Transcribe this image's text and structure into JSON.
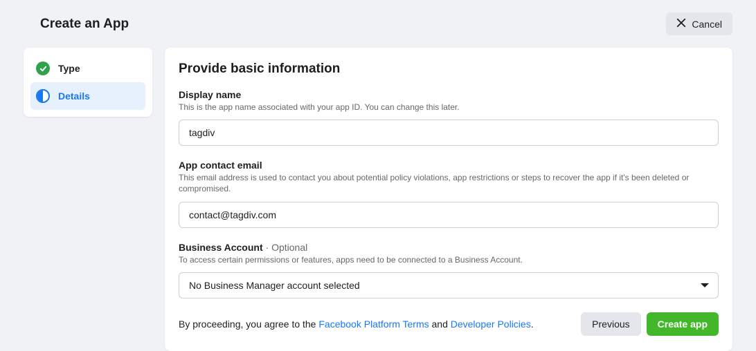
{
  "header": {
    "title": "Create an App",
    "cancel_label": "Cancel"
  },
  "sidebar": {
    "steps": [
      {
        "label": "Type",
        "state": "done"
      },
      {
        "label": "Details",
        "state": "current"
      }
    ]
  },
  "main": {
    "section_title": "Provide basic information",
    "display_name": {
      "label": "Display name",
      "desc": "This is the app name associated with your app ID. You can change this later.",
      "value": "tagdiv"
    },
    "contact_email": {
      "label": "App contact email",
      "desc": "This email address is used to contact you about potential policy violations, app restrictions or steps to recover the app if it's been deleted or compromised.",
      "value": "contact@tagdiv.com"
    },
    "business_account": {
      "label": "Business Account",
      "optional_text": " · Optional",
      "desc": "To access certain permissions or features, apps need to be connected to a Business Account.",
      "selected": "No Business Manager account selected"
    },
    "consent": {
      "prefix": "By proceeding, you agree to the ",
      "link1": "Facebook Platform Terms",
      "mid": " and ",
      "link2": "Developer Policies",
      "suffix": "."
    },
    "buttons": {
      "previous": "Previous",
      "create": "Create app"
    }
  }
}
